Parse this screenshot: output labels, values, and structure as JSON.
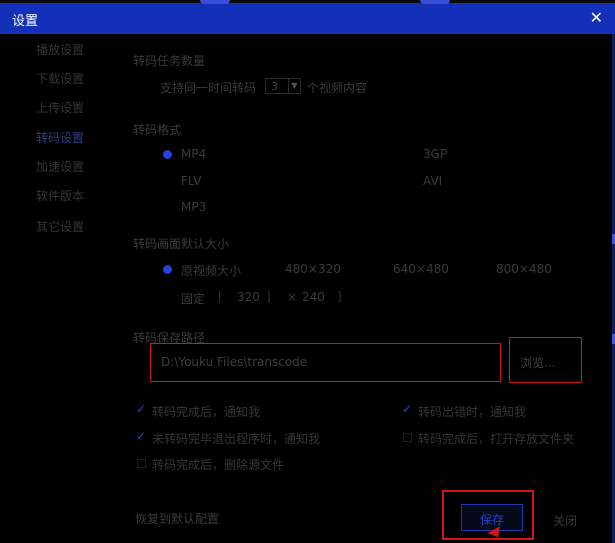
{
  "window": {
    "title": "设置",
    "close_icon": "✕"
  },
  "sidebar": {
    "items": [
      {
        "label": "播放设置"
      },
      {
        "label": "下载设置"
      },
      {
        "label": "上传设置"
      },
      {
        "label": "转码设置",
        "active": true
      },
      {
        "label": "加速设置"
      },
      {
        "label": "软件版本"
      },
      {
        "label": "其它设置"
      }
    ]
  },
  "task_count": {
    "title": "转码任务数量",
    "prefix": "支持同一时间转码",
    "value": "3",
    "suffix": "个视频内容"
  },
  "format": {
    "title": "转码格式",
    "options": [
      "MP4",
      "3GP",
      "FLV",
      "AVI",
      "MP3"
    ],
    "selected": "MP4"
  },
  "resolution": {
    "title": "转码画面默认大小",
    "options": [
      "原视频大小",
      "480×320",
      "640×480",
      "800×480"
    ],
    "selected": "原视频大小",
    "fixed_label": "固定",
    "fixed_width": "320",
    "fixed_sep": "×",
    "fixed_height": "240"
  },
  "save_path": {
    "title": "转码保存路径",
    "value": "D:\\Youku Files\\transcode",
    "browse_label": "浏览..."
  },
  "options": [
    {
      "label": "转码完成后，通知我",
      "checked": true
    },
    {
      "label": "转码出错时，通知我",
      "checked": true
    },
    {
      "label": "未转码完毕退出程序时，通知我",
      "checked": true
    },
    {
      "label": "转码完成后，打开存放文件夹",
      "checked": false
    },
    {
      "label": "转码完成后，删除源文件",
      "checked": false
    }
  ],
  "footer": {
    "restore_label": "恢复到默认配置",
    "save_label": "保存",
    "close_label": "关闭"
  },
  "colors": {
    "titlebar": "#1530b8",
    "accent": "#2a3fe0",
    "highlight": "#d11414"
  }
}
